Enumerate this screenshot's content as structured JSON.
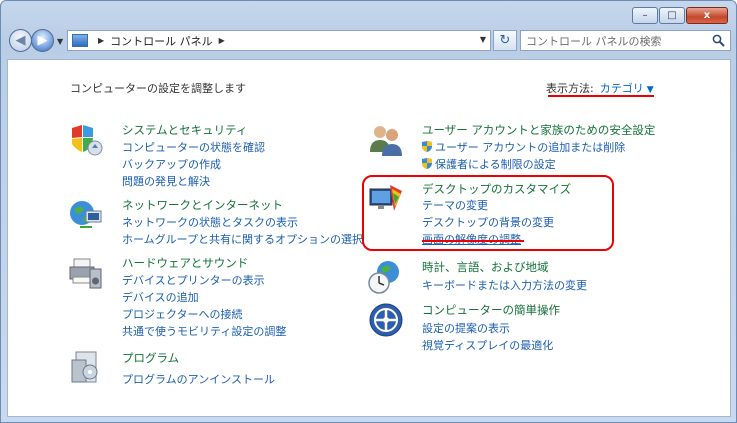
{
  "window": {
    "minimize_glyph": "–",
    "maximize_glyph": "□",
    "close_glyph": "x"
  },
  "address": {
    "crumbs": [
      "コントロール パネル"
    ],
    "search_placeholder": "コントロール パネルの検索"
  },
  "header": {
    "subtitle": "コンピューターの設定を調整します",
    "view_by_label": "表示方法:",
    "view_by_value": "カテゴリ"
  },
  "left_categories": [
    {
      "title": "システムとセキュリティ",
      "links": [
        "コンピューターの状態を確認",
        "バックアップの作成",
        "問題の発見と解決"
      ]
    },
    {
      "title": "ネットワークとインターネット",
      "links": [
        "ネットワークの状態とタスクの表示",
        "ホームグループと共有に関するオプションの選択"
      ]
    },
    {
      "title": "ハードウェアとサウンド",
      "links": [
        "デバイスとプリンターの表示",
        "デバイスの追加",
        "プロジェクターへの接続",
        "共通で使うモビリティ設定の調整"
      ]
    },
    {
      "title": "プログラム",
      "links": [
        "プログラムのアンインストール"
      ]
    }
  ],
  "right_categories": [
    {
      "title": "ユーザー アカウントと家族のための安全設定",
      "links": [
        "ユーザー アカウントの追加または削除",
        "保護者による制限の設定"
      ]
    },
    {
      "title": "デスクトップのカスタマイズ",
      "links": [
        "テーマの変更",
        "デスクトップの背景の変更",
        "画面の解像度の調整"
      ]
    },
    {
      "title": "時計、言語、および地域",
      "links": [
        "キーボードまたは入力方法の変更"
      ]
    },
    {
      "title": "コンピューターの簡単操作",
      "links": [
        "設定の提案の表示",
        "視覚ディスプレイの最適化"
      ]
    }
  ],
  "colors": {
    "category_title": "#14723a",
    "link": "#1b5eb0",
    "annotation_red": "#ee0000"
  }
}
